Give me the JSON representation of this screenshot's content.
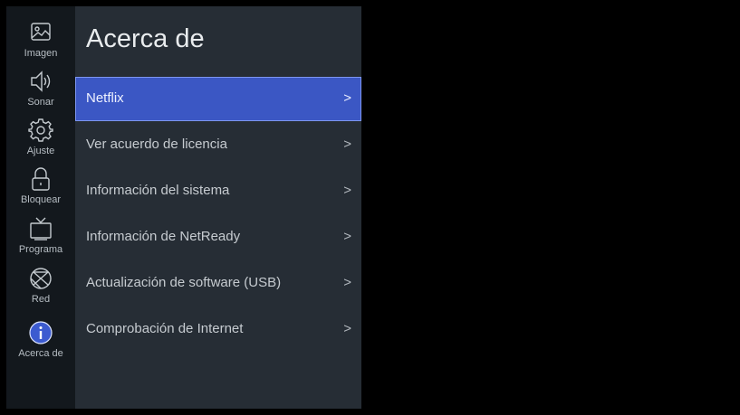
{
  "sidebar": {
    "items": [
      {
        "label": "Imagen",
        "icon": "image-icon"
      },
      {
        "label": "Sonar",
        "icon": "speaker-icon"
      },
      {
        "label": "Ajuste",
        "icon": "gear-icon"
      },
      {
        "label": "Bloquear",
        "icon": "lock-icon"
      },
      {
        "label": "Programa",
        "icon": "tv-icon"
      },
      {
        "label": "Red",
        "icon": "network-globe-icon"
      },
      {
        "label": "Acerca de",
        "icon": "info-icon",
        "selected": true
      }
    ]
  },
  "panel": {
    "title": "Acerca de",
    "items": [
      {
        "label": "Netflix",
        "chevron": ">",
        "selected": true
      },
      {
        "label": "Ver acuerdo de licencia",
        "chevron": ">"
      },
      {
        "label": "Información del sistema",
        "chevron": ">"
      },
      {
        "label": "Información de NetReady",
        "chevron": ">"
      },
      {
        "label": "Actualización de software (USB)",
        "chevron": ">"
      },
      {
        "label": "Comprobación de Internet",
        "chevron": ">"
      }
    ]
  },
  "colors": {
    "sidebar_bg": "#13181d",
    "panel_bg": "#262d35",
    "highlight": "#3b57c4",
    "info_icon": "#3c5bd0"
  }
}
